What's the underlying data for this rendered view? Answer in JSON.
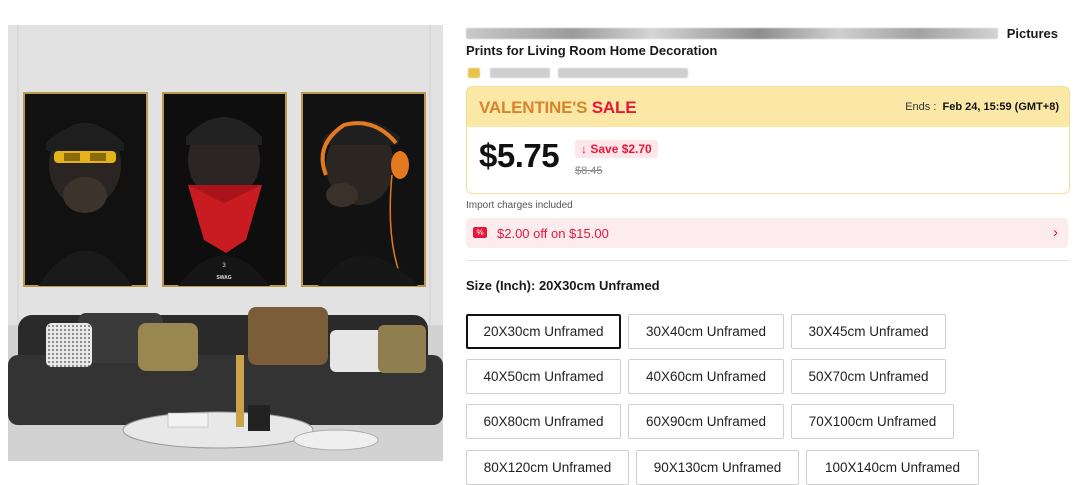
{
  "product": {
    "title_end": "Pictures",
    "title_line2": "Prints for Living Room Home Decoration"
  },
  "sale": {
    "title_a": "VALENTINE'S",
    "title_b": "SALE",
    "ends_label": "Ends :",
    "ends_value": "Feb 24, 15:59 (GMT+8)",
    "price": "$5.75",
    "save": "Save $2.70",
    "old_price": "$8.45"
  },
  "import_note": "Import charges included",
  "coupon": {
    "icon": "ticket-icon",
    "text": "$2.00 off on $15.00"
  },
  "size": {
    "label": "Size (Inch): 20X30cm Unframed",
    "selected": "20X30cm Unframed",
    "options": [
      "20X30cm Unframed",
      "30X40cm Unframed",
      "30X45cm Unframed",
      "40X50cm Unframed",
      "40X60cm Unframed",
      "50X70cm Unframed",
      "60X80cm Unframed",
      "60X90cm Unframed",
      "70X100cm Unframed",
      "80X120cm Unframed",
      "90X130cm Unframed",
      "100X140cm Unframed"
    ]
  },
  "image": {
    "poster_caption_a": "3",
    "poster_caption_b": "SWAG"
  },
  "colors": {
    "accent": "#e8173a",
    "sale_banner": "#fce8a6",
    "coupon_bg": "#fdecee"
  }
}
